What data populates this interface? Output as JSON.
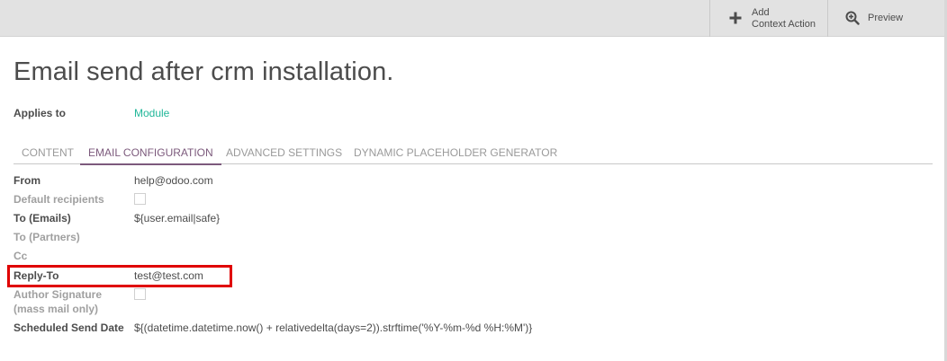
{
  "toolbar": {
    "add_context_action": [
      "Add",
      "Context Action"
    ],
    "preview_label": "Preview"
  },
  "page": {
    "title": "Email send after crm installation."
  },
  "applies_to": {
    "label": "Applies to",
    "value": "Module"
  },
  "tabs": [
    {
      "label": "CONTENT",
      "active": false
    },
    {
      "label": "EMAIL CONFIGURATION",
      "active": true
    },
    {
      "label": "ADVANCED SETTINGS",
      "active": false
    },
    {
      "label": "DYNAMIC PLACEHOLDER GENERATOR",
      "active": false
    }
  ],
  "fields": {
    "from": {
      "label": "From",
      "value": "help@odoo.com"
    },
    "default_recipients": {
      "label": "Default recipients",
      "checked": false
    },
    "to_emails": {
      "label": "To (Emails)",
      "value": "${user.email|safe}"
    },
    "to_partners": {
      "label": "To (Partners)",
      "value": ""
    },
    "cc": {
      "label": "Cc",
      "value": ""
    },
    "reply_to": {
      "label": "Reply-To",
      "value": "test@test.com"
    },
    "author_signature": {
      "label_line1": "Author Signature",
      "label_line2": "(mass mail only)",
      "checked": false
    },
    "scheduled_send_date": {
      "label": "Scheduled Send Date",
      "value": "${(datetime.datetime.now() + relativedelta(days=2)).strftime('%Y-%m-%d %H:%M')}"
    }
  },
  "colors": {
    "accent": "#7c5a7c",
    "link": "#21b799",
    "highlight": "#e00000"
  },
  "icons": {
    "add": "plus-icon",
    "preview": "magnifier-plus-icon"
  }
}
